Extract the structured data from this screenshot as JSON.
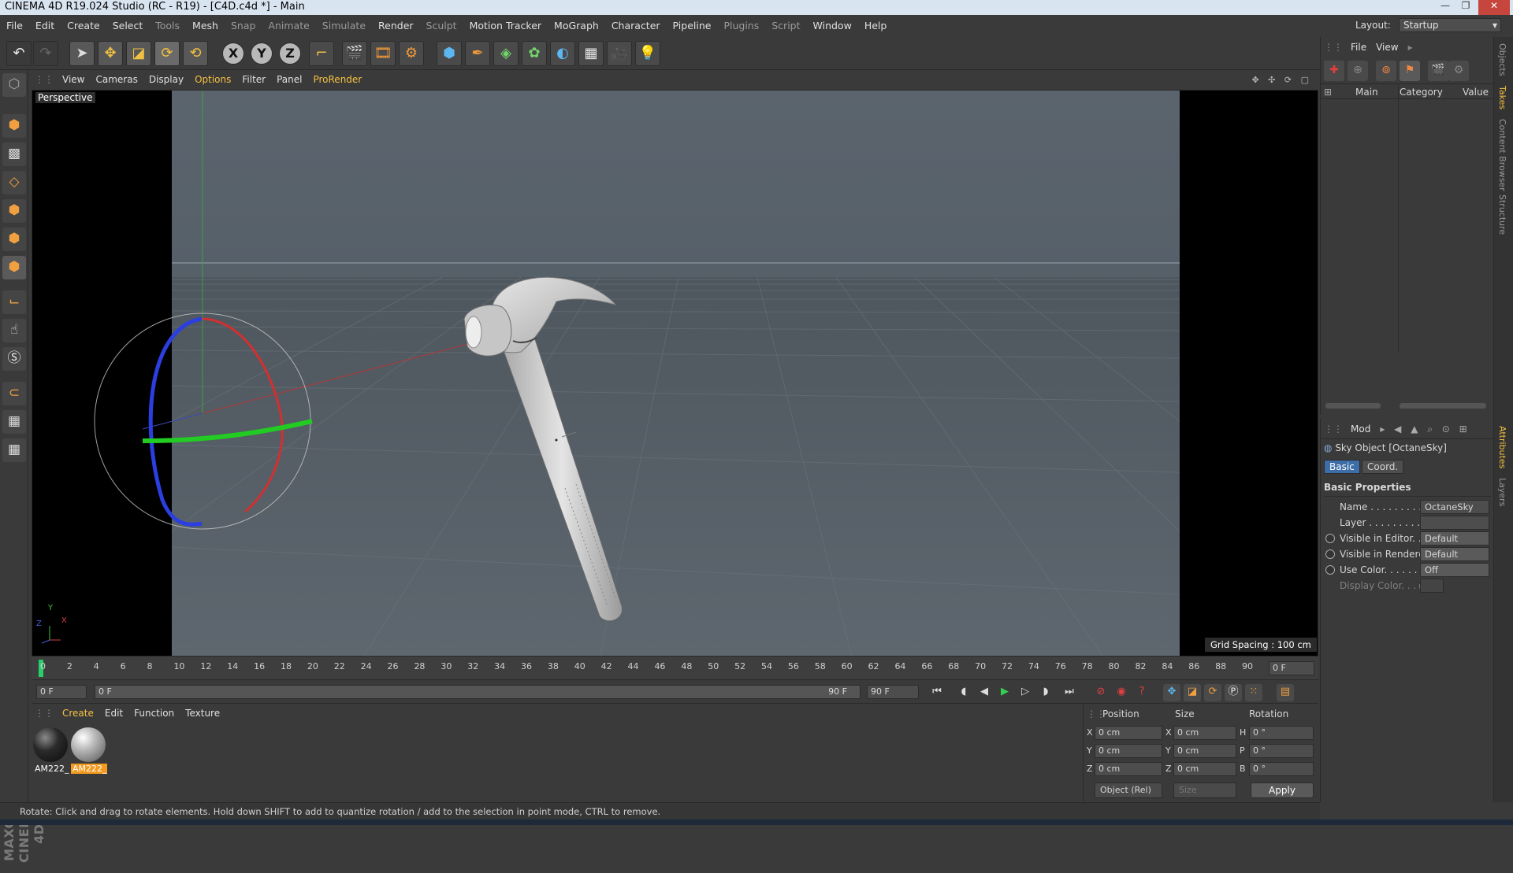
{
  "window": {
    "title": "CINEMA 4D R19.024 Studio (RC - R19) - [C4D.c4d *] - Main",
    "controls": [
      "—",
      "❐",
      "✕"
    ]
  },
  "menubar": {
    "items": [
      "File",
      "Edit",
      "Create",
      "Select",
      "Tools",
      "Mesh",
      "Snap",
      "Animate",
      "Simulate",
      "Render",
      "Sculpt",
      "Motion Tracker",
      "MoGraph",
      "Character",
      "Pipeline",
      "Plugins",
      "Script",
      "Window",
      "Help"
    ],
    "dim_items": [
      "Tools",
      "Snap",
      "Animate",
      "Simulate",
      "Sculpt",
      "Plugins",
      "Script"
    ]
  },
  "layout": {
    "label": "Layout:",
    "value": "Startup"
  },
  "toolbar": {
    "axis_x": "X",
    "axis_y": "Y",
    "axis_z": "Z"
  },
  "viewport": {
    "menu": [
      "View",
      "Cameras",
      "Display",
      "Options",
      "Filter",
      "Panel",
      "ProRender"
    ],
    "highlight": "Options",
    "label": "Perspective",
    "grid_spacing": "Grid Spacing : 100 cm",
    "axis_y": "Y",
    "axis_x": "X",
    "axis_z": "Z",
    "nav_icons": "✥ ✣ ⟳ ▢"
  },
  "timeline": {
    "ticks": [
      "0",
      "2",
      "4",
      "6",
      "8",
      "10",
      "12",
      "14",
      "16",
      "18",
      "20",
      "22",
      "24",
      "26",
      "28",
      "30",
      "32",
      "34",
      "36",
      "38",
      "40",
      "42",
      "44",
      "46",
      "48",
      "50",
      "52",
      "54",
      "56",
      "58",
      "60",
      "62",
      "64",
      "66",
      "68",
      "70",
      "72",
      "74",
      "76",
      "78",
      "80",
      "82",
      "84",
      "86",
      "88",
      "90"
    ],
    "end_frame": "0 F"
  },
  "transport": {
    "start": "0 F",
    "range_start": "0 F",
    "range_end": "90 F",
    "max": "90 F"
  },
  "materials": {
    "menu": [
      "Create",
      "Edit",
      "Function",
      "Texture"
    ],
    "highlight": "Create",
    "items": [
      {
        "label": "AM222_",
        "selected": false
      },
      {
        "label": "AM222_",
        "selected": true
      }
    ]
  },
  "coordinates": {
    "headers": {
      "position": "Position",
      "size": "Size",
      "rotation": "Rotation"
    },
    "rows": [
      {
        "axis": "X",
        "pos": "0 cm",
        "size_axis": "X",
        "size": "0 cm",
        "rot_axis": "H",
        "rot": "0 °"
      },
      {
        "axis": "Y",
        "pos": "0 cm",
        "size_axis": "Y",
        "size": "0 cm",
        "rot_axis": "P",
        "rot": "0 °"
      },
      {
        "axis": "Z",
        "pos": "0 cm",
        "size_axis": "Z",
        "size": "0 cm",
        "rot_axis": "B",
        "rot": "0 °"
      }
    ],
    "mode": "Object (Rel)",
    "size_mode": "Size",
    "apply": "Apply"
  },
  "status": {
    "text": "Rotate: Click and drag to rotate elements. Hold down SHIFT to add to quantize rotation / add to the selection in point mode, CTRL to remove."
  },
  "objects_panel": {
    "menu": [
      "File",
      "View"
    ],
    "columns": {
      "main": "Main",
      "category": "Category",
      "value": "Value"
    }
  },
  "attributes_panel": {
    "menu": "Mod",
    "title": "Sky Object [OctaneSky]",
    "tabs": [
      "Basic",
      "Coord."
    ],
    "active_tab": "Basic",
    "section": "Basic Properties",
    "rows": [
      {
        "label": "Name . . . . . . . . . .",
        "value": "OctaneSky",
        "radio": false
      },
      {
        "label": "Layer . . . . . . . . . .",
        "value": "",
        "radio": false
      },
      {
        "label": "Visible in Editor. . .",
        "value": "Default",
        "radio": true
      },
      {
        "label": "Visible in Renderer",
        "value": "Default",
        "radio": true
      },
      {
        "label": "Use Color. . . . . . .",
        "value": "Off",
        "radio": true
      },
      {
        "label": "Display Color. . . ▸",
        "value": "",
        "radio": false
      }
    ]
  },
  "side_tabs": [
    "Objects",
    "Takes",
    "Content Browser",
    "Structure",
    "Attributes",
    "Layers"
  ],
  "colors": {
    "accent": "#f5c242",
    "bg": "#3a3a3a",
    "viewport_bg": "#5f676f",
    "playhead": "#27d06a"
  }
}
